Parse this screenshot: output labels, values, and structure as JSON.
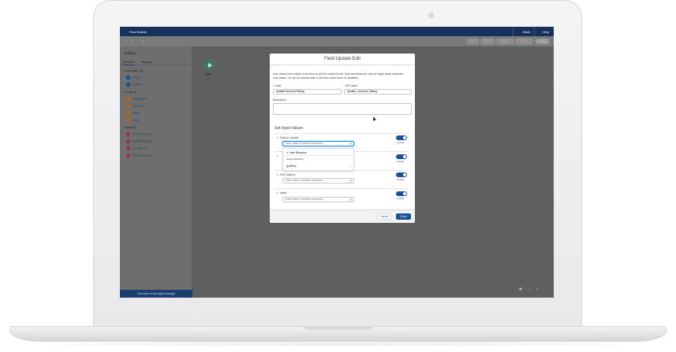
{
  "colors": {
    "header": "#16325c",
    "brand": "#1b5297",
    "overlay": "#5f5f5f"
  },
  "app": {
    "title": "Flow Builder",
    "back_label": "Back",
    "help_label": "Help"
  },
  "toolbar": {
    "buttons": [
      "Run",
      "Debug",
      "Save As",
      "Activate",
      "Save"
    ]
  },
  "sidebar": {
    "title": "Toolbox",
    "tabs": [
      "Elements",
      "Manager"
    ],
    "sections": [
      {
        "label": "Interaction (2)",
        "items": [
          "Action",
          "Subflow"
        ]
      },
      {
        "label": "Logic (4)",
        "items": [
          "Assignment",
          "Decision",
          "Pause",
          "Loop"
        ]
      },
      {
        "label": "Data (4)",
        "items": [
          "Create Records",
          "Update Records",
          "Get Records",
          "Delete Records"
        ]
      }
    ],
    "footer": "Get more on the AppExchange"
  },
  "canvas": {
    "start_label": "Start"
  },
  "modal": {
    "title": "Field Update Edit",
    "description": "Use values from earlier in the flow to set the inputs for the \"Add and welcome user to target slack channels\" core action. To use its outputs later in the flow, store them in variables.",
    "label_label": "Label",
    "label_value": "Update Account Rating",
    "api_label": "API Name",
    "api_value": "Update_Account_Rating",
    "desc_label": "Description",
    "section_title": "Set Input Values",
    "rows": [
      {
        "label": "Field to Update",
        "placeholder": "Enter value or search resources...",
        "toggle": "Include"
      },
      {
        "label": "Field Name",
        "placeholder": "Enter value or search resources...",
        "toggle": "Include"
      },
      {
        "label": "Text Options",
        "placeholder": "Enter value or search resources...",
        "toggle": "Include"
      },
      {
        "label": "Value",
        "placeholder": "Enter value or search resources...",
        "toggle": "Include"
      }
    ],
    "dropdown": {
      "new_resource": "New Resource",
      "group": "Global Variables",
      "flow": "$Flow"
    },
    "cancel_label": "Cancel",
    "done_label": "Done"
  }
}
